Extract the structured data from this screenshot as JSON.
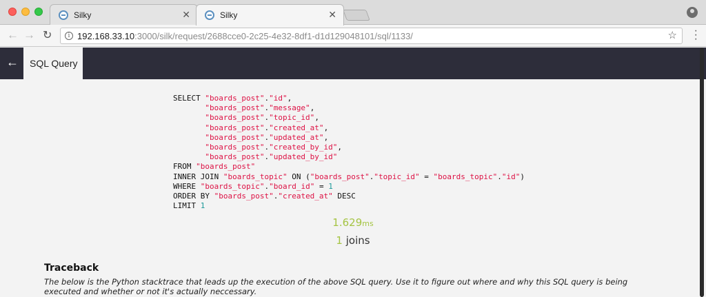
{
  "browser": {
    "tabs": [
      {
        "title": "Silky"
      },
      {
        "title": "Silky"
      }
    ],
    "url_host": "192.168.33.10",
    "url_rest": ":3000/silk/request/2688cce0-2c25-4e32-8df1-d1d129048101/sql/1133/"
  },
  "app": {
    "tab_label": "SQL Query"
  },
  "sql": {
    "lines": [
      [
        [
          "k",
          "SELECT "
        ],
        [
          "s",
          "\"boards_post\""
        ],
        [
          "k",
          "."
        ],
        [
          "s",
          "\"id\""
        ],
        [
          "k",
          ","
        ]
      ],
      [
        [
          "k",
          "       "
        ],
        [
          "s",
          "\"boards_post\""
        ],
        [
          "k",
          "."
        ],
        [
          "s",
          "\"message\""
        ],
        [
          "k",
          ","
        ]
      ],
      [
        [
          "k",
          "       "
        ],
        [
          "s",
          "\"boards_post\""
        ],
        [
          "k",
          "."
        ],
        [
          "s",
          "\"topic_id\""
        ],
        [
          "k",
          ","
        ]
      ],
      [
        [
          "k",
          "       "
        ],
        [
          "s",
          "\"boards_post\""
        ],
        [
          "k",
          "."
        ],
        [
          "s",
          "\"created_at\""
        ],
        [
          "k",
          ","
        ]
      ],
      [
        [
          "k",
          "       "
        ],
        [
          "s",
          "\"boards_post\""
        ],
        [
          "k",
          "."
        ],
        [
          "s",
          "\"updated_at\""
        ],
        [
          "k",
          ","
        ]
      ],
      [
        [
          "k",
          "       "
        ],
        [
          "s",
          "\"boards_post\""
        ],
        [
          "k",
          "."
        ],
        [
          "s",
          "\"created_by_id\""
        ],
        [
          "k",
          ","
        ]
      ],
      [
        [
          "k",
          "       "
        ],
        [
          "s",
          "\"boards_post\""
        ],
        [
          "k",
          "."
        ],
        [
          "s",
          "\"updated_by_id\""
        ]
      ],
      [
        [
          "k",
          "FROM "
        ],
        [
          "s",
          "\"boards_post\""
        ]
      ],
      [
        [
          "k",
          "INNER JOIN "
        ],
        [
          "s",
          "\"boards_topic\""
        ],
        [
          "k",
          " ON ("
        ],
        [
          "s",
          "\"boards_post\""
        ],
        [
          "k",
          "."
        ],
        [
          "s",
          "\"topic_id\""
        ],
        [
          "k",
          " = "
        ],
        [
          "s",
          "\"boards_topic\""
        ],
        [
          "k",
          "."
        ],
        [
          "s",
          "\"id\""
        ],
        [
          "k",
          ")"
        ]
      ],
      [
        [
          "k",
          "WHERE "
        ],
        [
          "s",
          "\"boards_topic\""
        ],
        [
          "k",
          "."
        ],
        [
          "s",
          "\"board_id\""
        ],
        [
          "k",
          " = "
        ],
        [
          "n",
          "1"
        ]
      ],
      [
        [
          "k",
          "ORDER BY "
        ],
        [
          "s",
          "\"boards_post\""
        ],
        [
          "k",
          "."
        ],
        [
          "s",
          "\"created_at\""
        ],
        [
          "k",
          " DESC"
        ]
      ],
      [
        [
          "k",
          "LIMIT "
        ],
        [
          "n",
          "1"
        ]
      ]
    ]
  },
  "stats": {
    "time_value": "1.629",
    "time_unit": "ms",
    "joins_count": "1",
    "joins_label": "joins"
  },
  "traceback": {
    "heading": "Traceback",
    "description": "The below is the Python stacktrace that leads up the execution of the above SQL query. Use it to figure out where and why this SQL query is being executed and whether or not it's actually neccessary."
  },
  "colors": {
    "header_bg": "#2d2d3a",
    "accent": "#a5c443",
    "sql_string": "#d14",
    "sql_number": "#1a9999"
  }
}
